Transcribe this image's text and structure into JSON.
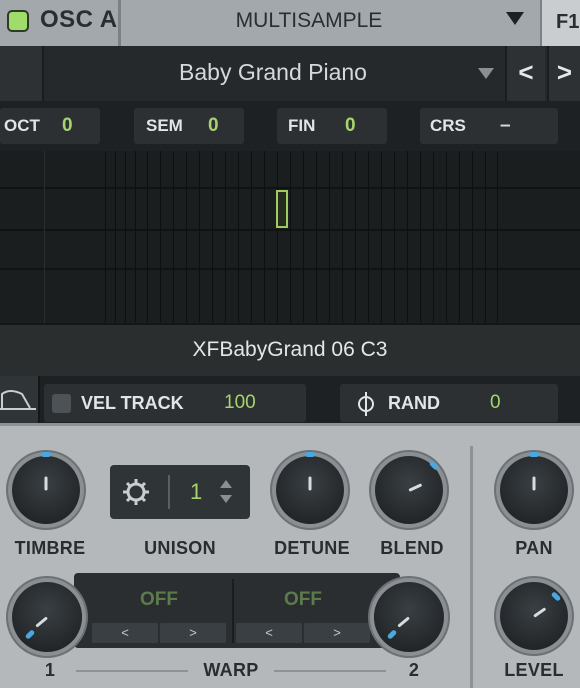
{
  "header": {
    "osc_title": "OSC A",
    "mode": "MULTISAMPLE",
    "f1_tab": "F1"
  },
  "preset": {
    "name": "Baby Grand Piano",
    "prev": "<",
    "next": ">"
  },
  "tuning": [
    {
      "label": "OCT",
      "value": "0"
    },
    {
      "label": "SEM",
      "value": "0"
    },
    {
      "label": "FIN",
      "value": "0"
    },
    {
      "label": "CRS",
      "value": "–"
    }
  ],
  "sample": {
    "name": "XFBabyGrand 06 C3"
  },
  "velocity": {
    "label": "VEL TRACK",
    "value": "100",
    "enabled": false
  },
  "random": {
    "label": "RAND",
    "value": "0"
  },
  "knobs": {
    "timbre": "TIMBRE",
    "unison": "UNISON",
    "detune": "DETUNE",
    "blend": "BLEND",
    "pan": "PAN",
    "level": "LEVEL",
    "warp1": "1",
    "warp2": "2",
    "warp": "WARP"
  },
  "unison": {
    "value": "1"
  },
  "warp_slots": [
    {
      "value": "OFF",
      "prev": "<",
      "next": ">"
    },
    {
      "value": "OFF",
      "prev": "<",
      "next": ">"
    }
  ],
  "colors": {
    "accent_green": "#9fdc6b",
    "value_green": "#a6d46c",
    "knob_indicator": "#4aa7e0"
  }
}
